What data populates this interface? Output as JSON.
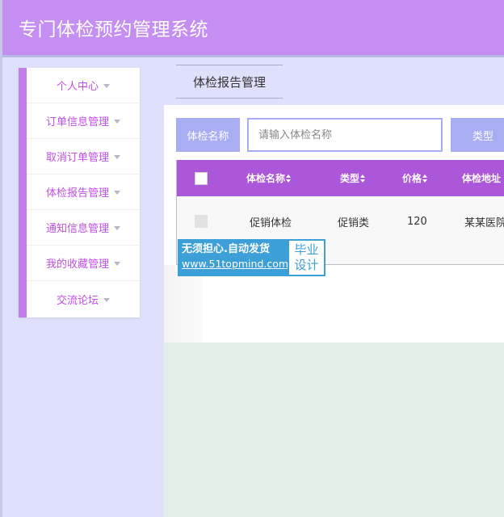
{
  "header": {
    "title": "专门体检预约管理系统"
  },
  "sidebar": {
    "items": [
      {
        "label": "个人中心"
      },
      {
        "label": "订单信息管理"
      },
      {
        "label": "取消订单管理"
      },
      {
        "label": "体检报告管理"
      },
      {
        "label": "通知信息管理"
      },
      {
        "label": "我的收藏管理"
      },
      {
        "label": "交流论坛"
      }
    ]
  },
  "breadcrumb": {
    "current": "体检报告管理"
  },
  "search": {
    "label": "体检名称",
    "placeholder": "请输入体检名称",
    "value": "",
    "type_label": "类型"
  },
  "table": {
    "columns": [
      "体检名称",
      "类型",
      "价格",
      "体检地址"
    ],
    "rows": [
      {
        "name": "促销体检",
        "type": "促销类",
        "price": "120",
        "address": "某某医院"
      }
    ]
  },
  "ad": {
    "slogan": "无须担心.自动发货",
    "url": "www.51topmind.com",
    "tag_line1": "毕业",
    "tag_line2": "设计"
  },
  "colors": {
    "header_bg": "#c48ef2",
    "accent_purple": "#ac56d9",
    "menu_text": "#c04fe3",
    "search_accent": "#a9adf2",
    "page_bg": "#dfe0fb",
    "ad_blue": "#3d9fd7"
  }
}
